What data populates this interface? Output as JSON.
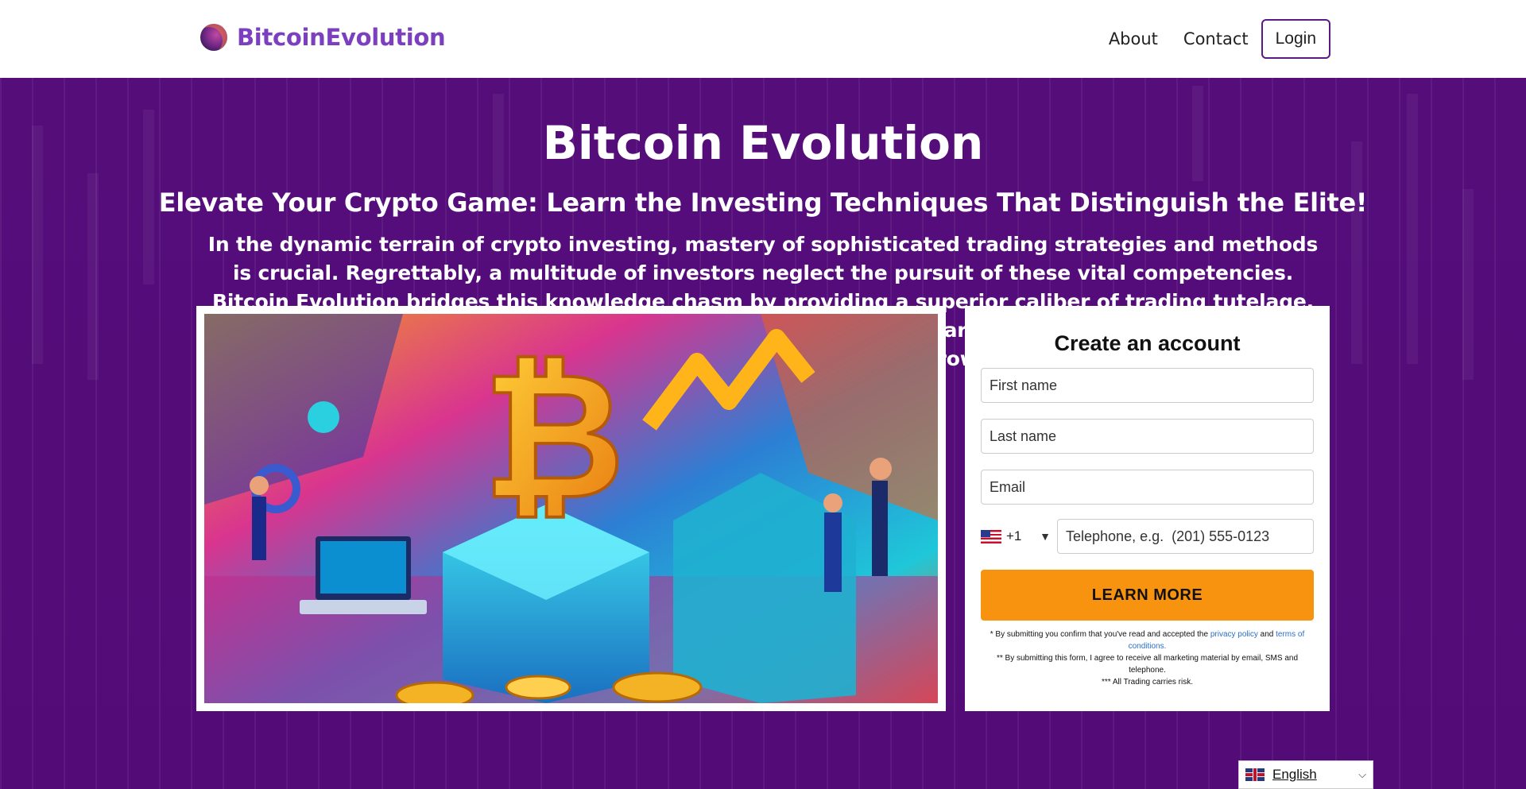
{
  "header": {
    "logo_text": "BitcoinEvolution",
    "nav": [
      "About",
      "Contact"
    ],
    "login_label": "Login"
  },
  "hero": {
    "title": "Bitcoin Evolution",
    "subtitle": "Elevate Your Crypto Game: Learn the Investing Techniques That Distinguish the Elite!",
    "description": "In the dynamic terrain of crypto investing, mastery of sophisticated trading strategies and methods is crucial. Regrettably, a multitude of investors neglect the pursuit of these vital competencies. Bitcoin Evolution bridges this knowledge chasm by providing a superior caliber of trading tutelage. In addition, we empower crypto investors by linking them to an array of exceptional third-party resources to enhance their analytical prowess."
  },
  "form": {
    "title": "Create an account",
    "first_name_placeholder": "First name",
    "last_name_placeholder": "Last name",
    "email_placeholder": "Email",
    "country_code": "+1",
    "country_arrow": "▼",
    "phone_placeholder": "Telephone, e.g.  (201) 555-0123",
    "submit_label": "LEARN MORE",
    "disclaimer_1_prefix": "* By submitting you confirm that you've read and accepted the",
    "privacy_link": "privacy policy",
    "disclaimer_1_and": "and",
    "terms_link": "terms of conditions.",
    "disclaimer_2": "** By submitting this form, I agree to receive all marketing material by email, SMS and telephone.",
    "disclaimer_3": "*** All Trading carries risk."
  },
  "language": {
    "selected": "English",
    "caret": "⌵"
  },
  "colors": {
    "brand": "#7b3fbf",
    "hero_bg": "#550d7a",
    "cta": "#f7930f",
    "link": "#2a6fc9"
  }
}
